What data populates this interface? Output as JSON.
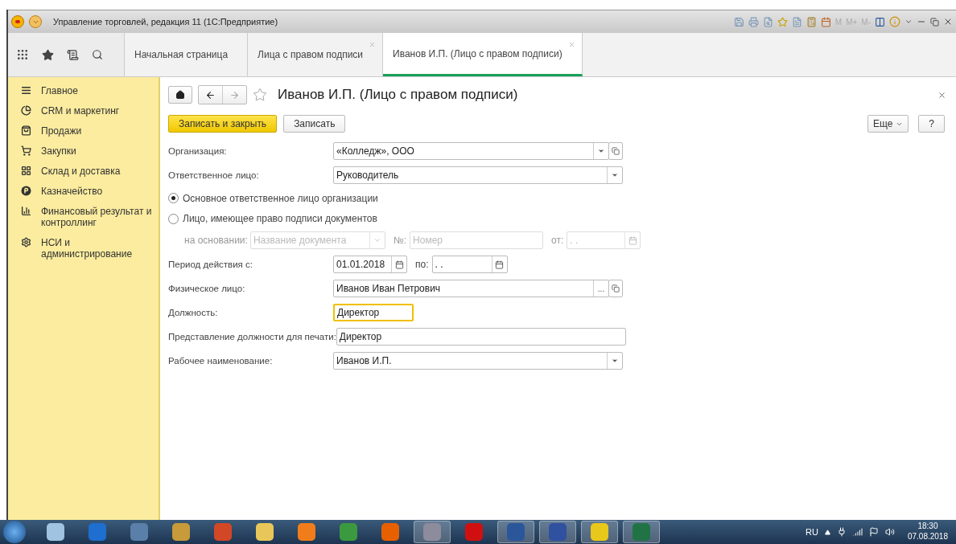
{
  "window": {
    "title": "Управление торговлей, редакция 11  (1С:Предприятие)",
    "memory_buttons": [
      "M",
      "M+",
      "M-"
    ]
  },
  "tabs": [
    {
      "label": "Начальная страница",
      "selected": false,
      "closable": false
    },
    {
      "label": "Лица с правом подписи",
      "selected": false,
      "closable": true
    },
    {
      "label": "Иванов И.П. (Лицо с правом подписи)",
      "selected": true,
      "closable": true
    }
  ],
  "sidebar": {
    "items": [
      {
        "label": "Главное"
      },
      {
        "label": "CRM и маркетинг"
      },
      {
        "label": "Продажи"
      },
      {
        "label": "Закупки"
      },
      {
        "label": "Склад и доставка"
      },
      {
        "label": "Казначейство"
      },
      {
        "label": "Финансовый результат и контроллинг"
      },
      {
        "label": "НСИ и администрирование"
      }
    ]
  },
  "form": {
    "title": "Иванов И.П. (Лицо с правом подписи)",
    "buttons": {
      "primary": "Записать и закрыть",
      "secondary": "Записать",
      "more": "Еще",
      "help": "?"
    },
    "rows": [
      {
        "kind": "field",
        "label": "Организация:",
        "value": "«Колледж», ООО",
        "dropdown": true,
        "open_button": true
      },
      {
        "kind": "field",
        "label": "Ответственное лицо:",
        "value": "Руководитель",
        "dropdown": true,
        "open_button": false
      },
      {
        "kind": "radio",
        "label": "Основное ответственное лицо организации",
        "selected": true
      },
      {
        "kind": "radio",
        "label": "Лицо, имеющее право подписи документов",
        "selected": false
      },
      {
        "kind": "basis",
        "label": "на основании:",
        "doc_placeholder": "Название документа",
        "number_label": "№:",
        "number_placeholder": "Номер",
        "date_label": "от:",
        "date_value": ".  .",
        "disabled": true
      },
      {
        "kind": "period",
        "label": "Период действия с:",
        "from": "01.01.2018",
        "to_label": "по:",
        "to": ".  ."
      },
      {
        "kind": "field",
        "label": "Физическое лицо:",
        "value": "Иванов Иван Петрович",
        "choose_button": "...",
        "open_button": true
      },
      {
        "kind": "short",
        "label": "Должность:",
        "value": "Директор",
        "focused": true
      },
      {
        "kind": "field",
        "label": "Представление должности для печати:",
        "value": "Директор"
      },
      {
        "kind": "field",
        "label": "Рабочее наименование:",
        "value": "Иванов И.П.",
        "dropdown": true,
        "open_button": false
      }
    ]
  },
  "taskbar": {
    "apps": [
      {
        "color": "#9fc3e0",
        "running": false
      },
      {
        "color": "#1e6fd0",
        "running": false
      },
      {
        "color": "#5a7fa8",
        "running": false
      },
      {
        "color": "#c79a3a",
        "running": false
      },
      {
        "color": "#d24726",
        "running": false
      },
      {
        "color": "#e8c65a",
        "running": false
      },
      {
        "color": "#f07d1a",
        "running": false
      },
      {
        "color": "#3b9a3f",
        "running": false
      },
      {
        "color": "#e66000",
        "running": false
      },
      {
        "color": "#8c8c9c",
        "running": true
      },
      {
        "color": "#d01010",
        "running": false
      },
      {
        "color": "#2b579a",
        "running": true
      },
      {
        "color": "#3050a0",
        "running": true
      },
      {
        "color": "#e8c81a",
        "running": true
      },
      {
        "color": "#217346",
        "running": true
      }
    ],
    "language": "RU",
    "time": "18:30",
    "date": "07.08.2018"
  }
}
